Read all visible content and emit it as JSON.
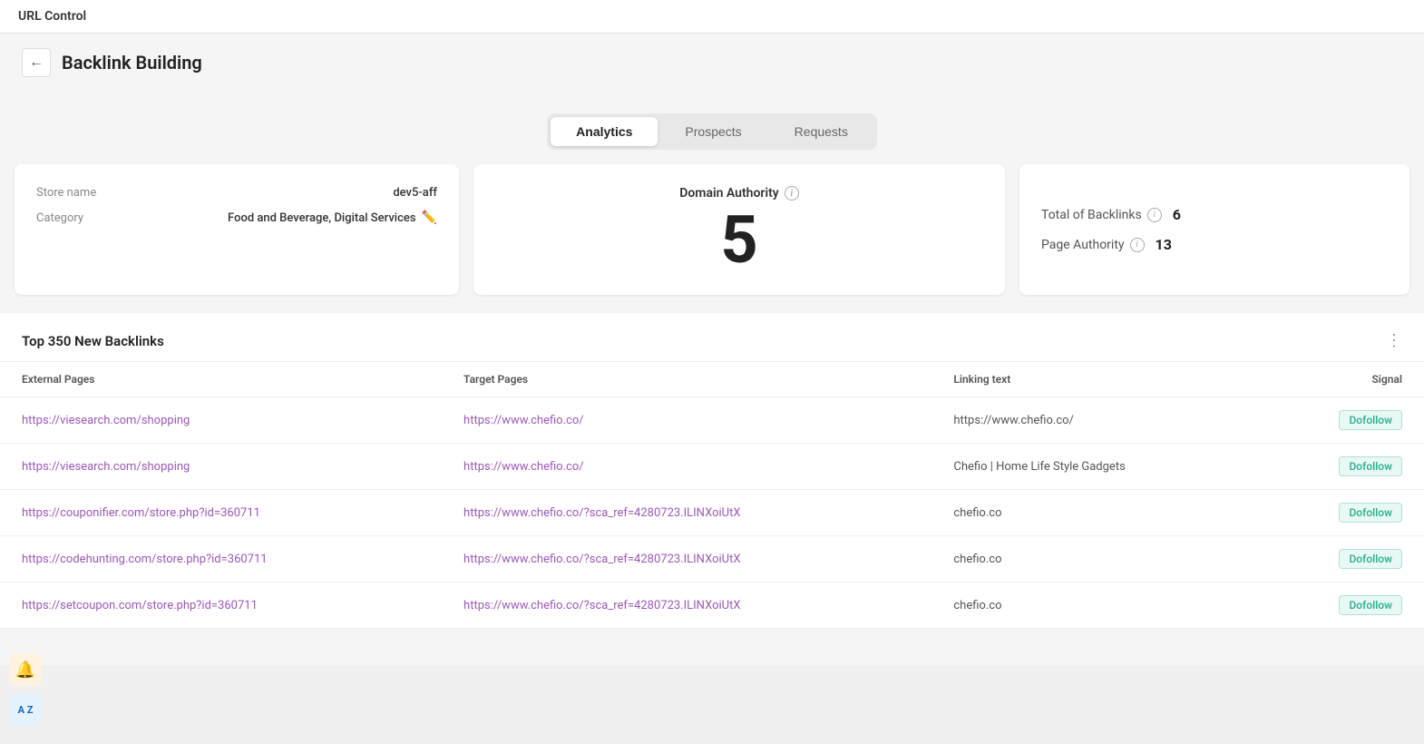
{
  "app": {
    "title": "URL Control"
  },
  "header": {
    "back_label": "←",
    "page_title": "Backlink Building"
  },
  "tabs": [
    {
      "id": "analytics",
      "label": "Analytics",
      "active": true
    },
    {
      "id": "prospects",
      "label": "Prospects",
      "active": false
    },
    {
      "id": "requests",
      "label": "Requests",
      "active": false
    }
  ],
  "store_card": {
    "store_name_label": "Store name",
    "store_name_value": "dev5-aff",
    "category_label": "Category",
    "category_value": "Food and Beverage, Digital Services"
  },
  "domain_card": {
    "title": "Domain Authority",
    "value": "5"
  },
  "authority_card": {
    "backlinks_label": "Total of Backlinks",
    "backlinks_value": "6",
    "page_authority_label": "Page Authority",
    "page_authority_value": "13"
  },
  "backlinks_section": {
    "title": "Top 350 New Backlinks"
  },
  "table": {
    "columns": [
      {
        "id": "external_pages",
        "label": "External Pages"
      },
      {
        "id": "target_pages",
        "label": "Target Pages"
      },
      {
        "id": "linking_text",
        "label": "Linking text"
      },
      {
        "id": "signal",
        "label": "Signal"
      }
    ],
    "rows": [
      {
        "external_page": "https://viesearch.com/shopping",
        "target_page": "https://www.chefio.co/",
        "linking_text": "https://www.chefio.co/",
        "signal": "Dofollow"
      },
      {
        "external_page": "https://viesearch.com/shopping",
        "target_page": "https://www.chefio.co/",
        "linking_text": "Chefio | Home Life Style Gadgets",
        "signal": "Dofollow"
      },
      {
        "external_page": "https://couponifier.com/store.php?id=360711",
        "target_page": "https://www.chefio.co/?sca_ref=4280723.ILINXoiUtX",
        "linking_text": "chefio.co",
        "signal": "Dofollow"
      },
      {
        "external_page": "https://codehunting.com/store.php?id=360711",
        "target_page": "https://www.chefio.co/?sca_ref=4280723.ILINXoiUtX",
        "linking_text": "chefio.co",
        "signal": "Dofollow"
      },
      {
        "external_page": "https://setcoupon.com/store.php?id=360711",
        "target_page": "https://www.chefio.co/?sca_ref=4280723.ILINXoiUtX",
        "linking_text": "chefio.co",
        "signal": "Dofollow"
      }
    ]
  },
  "bottom_icons": {
    "bell": "🔔",
    "translate": "A Z"
  }
}
